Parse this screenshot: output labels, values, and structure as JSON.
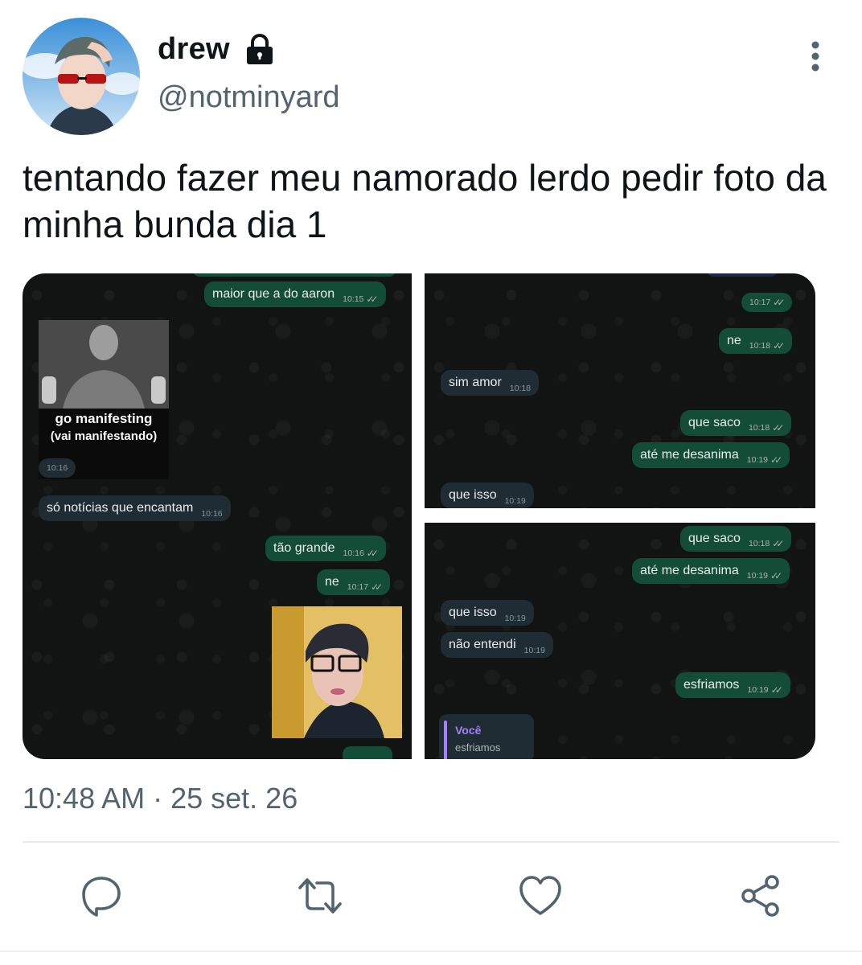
{
  "header": {
    "display_name": "drew",
    "handle": "@notminyard",
    "locked": true
  },
  "tweet": {
    "text": "tentando fazer meu namorado lerdo pedir foto da minha bunda dia 1",
    "timestamp": "10:48 AM · 25 set. 26"
  },
  "screenshots": {
    "left": {
      "messages": [
        {
          "dir": "out",
          "text": "maior que a do aaron",
          "time": "10:15"
        },
        {
          "dir": "in",
          "text": "",
          "time": "10:16"
        },
        {
          "dir": "in",
          "text": "só notícias que encantam",
          "time": "10:16"
        },
        {
          "dir": "out",
          "text": "tão grande",
          "time": "10:16"
        },
        {
          "dir": "out",
          "text": "ne",
          "time": "10:17"
        }
      ],
      "meme_caption_1": "go manifesting",
      "meme_caption_2": "(vai manifestando)"
    },
    "right_top": {
      "messages": [
        {
          "dir": "out",
          "text": "",
          "time": "10:17"
        },
        {
          "dir": "out",
          "text": "ne",
          "time": "10:18"
        },
        {
          "dir": "in",
          "text": "sim amor",
          "time": "10:18"
        },
        {
          "dir": "out",
          "text": "que saco",
          "time": "10:18"
        },
        {
          "dir": "out",
          "text": "até me desanima",
          "time": "10:19"
        },
        {
          "dir": "in",
          "text": "que isso",
          "time": "10:19"
        }
      ]
    },
    "right_bottom": {
      "messages": [
        {
          "dir": "out",
          "text": "que saco",
          "time": "10:18"
        },
        {
          "dir": "out",
          "text": "até me desanima",
          "time": "10:19"
        },
        {
          "dir": "in",
          "text": "que isso",
          "time": "10:19"
        },
        {
          "dir": "in",
          "text": "não entendi",
          "time": "10:19"
        },
        {
          "dir": "out",
          "text": "esfriamos",
          "time": "10:19"
        }
      ],
      "reply_author": "Você",
      "reply_text": "esfriamos"
    }
  },
  "actions": [
    {
      "name": "reply",
      "icon": "reply-icon"
    },
    {
      "name": "retweet",
      "icon": "retweet-icon"
    },
    {
      "name": "like",
      "icon": "heart-icon"
    },
    {
      "name": "share",
      "icon": "share-icon"
    }
  ],
  "colors": {
    "secondary_text": "#536471",
    "outgoing_bubble": "#144d37",
    "incoming_bubble": "#202c33",
    "chat_background": "#111413",
    "reply_accent": "#a580ff"
  }
}
